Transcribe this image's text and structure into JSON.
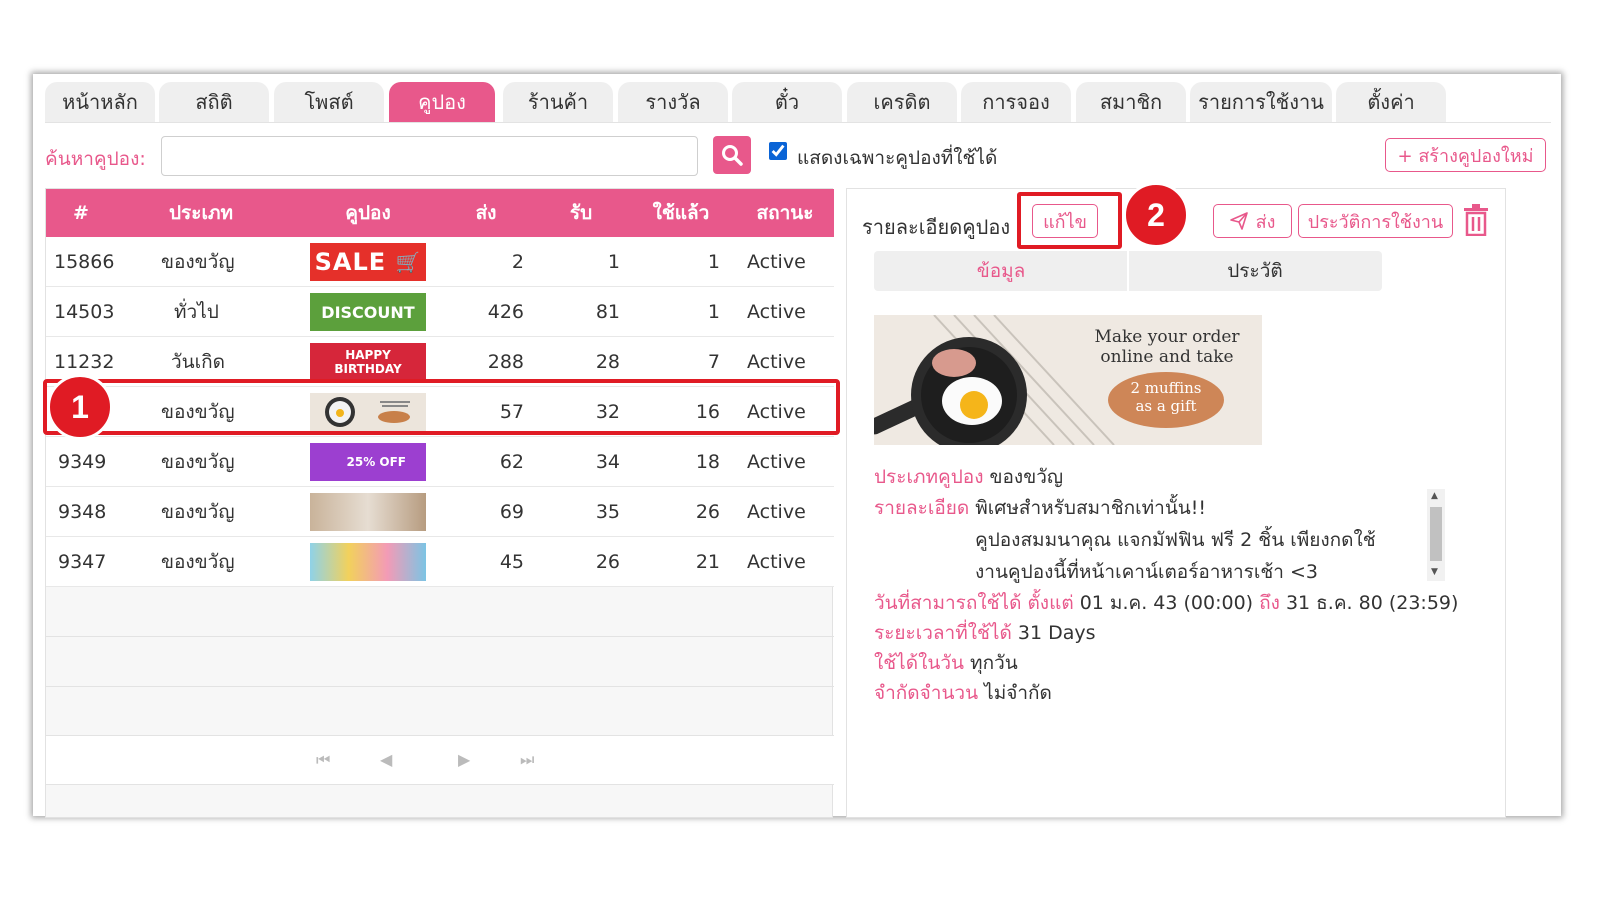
{
  "tabs": [
    "หน้าหลัก",
    "สถิติ",
    "โพสต์",
    "คูปอง",
    "ร้านค้า",
    "รางวัล",
    "ตั๋ว",
    "เครดิต",
    "การจอง",
    "สมาชิก",
    "รายการใช้งาน",
    "ตั้งค่า"
  ],
  "active_tab": "คูปอง",
  "search": {
    "label": "ค้นหาคูปอง:",
    "value": "",
    "placeholder": ""
  },
  "filter": {
    "label": "แสดงเฉพาะคูปองที่ใช้ได้",
    "checked": true
  },
  "create_button": "+ สร้างคูปองใหม่",
  "table": {
    "headers": [
      "#",
      "ประเภท",
      "คูปอง",
      "ส่ง",
      "รับ",
      "ใช้แล้ว",
      "สถานะ"
    ],
    "rows": [
      {
        "id": "15866",
        "type": "ของขวัญ",
        "coupon_text": "SALE",
        "sent": "2",
        "received": "1",
        "used": "1",
        "status": "Active"
      },
      {
        "id": "14503",
        "type": "ทั่วไป",
        "coupon_text": "DISCOUNT",
        "sent": "426",
        "received": "81",
        "used": "1",
        "status": "Active"
      },
      {
        "id": "11232",
        "type": "วันเกิด",
        "coupon_text": "HAPPY BIRTHDAY",
        "sent": "288",
        "received": "28",
        "used": "7",
        "status": "Active"
      },
      {
        "id": "",
        "type": "ของขวัญ",
        "coupon_text": "",
        "sent": "57",
        "received": "32",
        "used": "16",
        "status": "Active"
      },
      {
        "id": "9349",
        "type": "ของขวัญ",
        "coupon_text": "25% OFF",
        "sent": "62",
        "received": "34",
        "used": "18",
        "status": "Active"
      },
      {
        "id": "9348",
        "type": "ของขวัญ",
        "coupon_text": "",
        "sent": "69",
        "received": "35",
        "used": "26",
        "status": "Active"
      },
      {
        "id": "9347",
        "type": "ของขวัญ",
        "coupon_text": "",
        "sent": "45",
        "received": "26",
        "used": "21",
        "status": "Active"
      }
    ]
  },
  "markers": {
    "first": "1",
    "second": "2"
  },
  "detail": {
    "title": "รายละเอียดคูปอง",
    "edit_button": "แก้ไข",
    "send_button": "ส่ง",
    "history_button": "ประวัติการใช้งาน",
    "subtabs": [
      "ข้อมูล",
      "ประวัติ"
    ],
    "image_text_1": "Make your order",
    "image_text_2": "online and take",
    "image_text_3": "2 muffins",
    "image_text_4": "as a gift",
    "type_label": "ประเภทคูปอง",
    "type_value": "ของขวัญ",
    "desc_label": "รายละเอียด",
    "desc_line1": "พิเศษสำหรับสมาชิกเท่านั้น!!",
    "desc_line2": "คูปองสมมนาคุณ แจกมัฟฟิน ฟรี 2 ชิ้น เพียงกดใช้",
    "desc_line3": "งานคูปองนี้ที่หน้าเคาน์เตอร์อาหารเช้า <3",
    "date_label": "วันที่สามารถใช้ได้",
    "date_from_label": "ตั้งแต่",
    "date_from": "01 ม.ค. 43 (00:00)",
    "date_to_label": "ถึง",
    "date_to": "31 ธ.ค. 80 (23:59)",
    "duration_label": "ระยะเวลาที่ใช้ได้",
    "duration_value": "31 Days",
    "days_label": "ใช้ได้ในวัน",
    "days_value": "ทุกวัน",
    "limit_label": "จำกัดจำนวน",
    "limit_value": "ไม่จำกัด"
  },
  "colors": {
    "accent": "#e8588b",
    "highlight": "#e01b24"
  }
}
